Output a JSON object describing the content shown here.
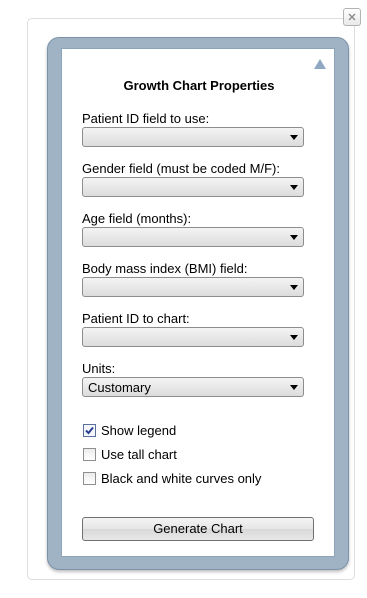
{
  "panel": {
    "title": "Growth Chart Properties"
  },
  "fields": [
    {
      "label": "Patient ID field to use:",
      "value": ""
    },
    {
      "label": "Gender field (must be coded M/F):",
      "value": ""
    },
    {
      "label": "Age field (months):",
      "value": ""
    },
    {
      "label": "Body mass index (BMI) field:",
      "value": ""
    },
    {
      "label": "Patient ID to chart:",
      "value": ""
    },
    {
      "label": "Units:",
      "value": "Customary"
    }
  ],
  "options": [
    {
      "label": "Show legend",
      "checked": true
    },
    {
      "label": "Use tall chart",
      "checked": false
    },
    {
      "label": "Black and white curves only",
      "checked": false
    }
  ],
  "actions": {
    "generate_label": "Generate Chart"
  },
  "icons": {
    "close": "close-icon",
    "collapse": "collapse-up-icon",
    "dropdown": "chevron-down-icon",
    "check": "checkmark-icon"
  },
  "colors": {
    "panel_border": "#9fb3c5",
    "collapse_arrow": "#8fa9c4",
    "check": "#2b3f8f"
  }
}
